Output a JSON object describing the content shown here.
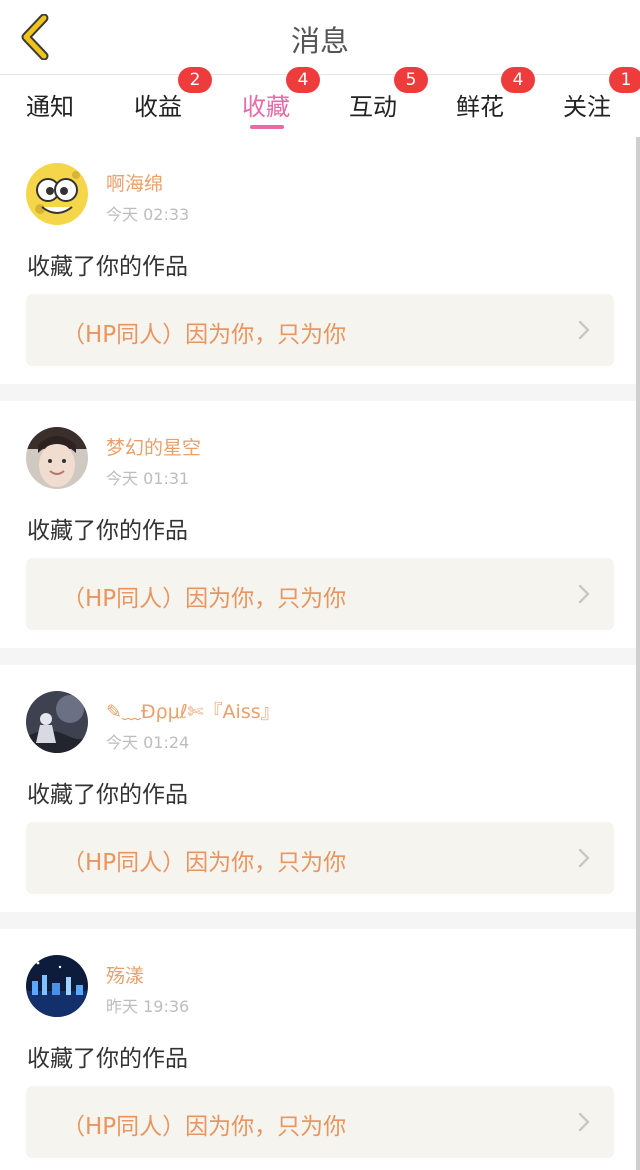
{
  "header": {
    "title": "消息",
    "back_icon": "back-chevron-icon"
  },
  "tabs": [
    {
      "label": "通知",
      "badge": ""
    },
    {
      "label": "收益",
      "badge": "2"
    },
    {
      "label": "收藏",
      "badge": "4",
      "active": true
    },
    {
      "label": "互动",
      "badge": "5"
    },
    {
      "label": "鲜花",
      "badge": "4"
    },
    {
      "label": "关注",
      "badge": "1"
    }
  ],
  "colors": {
    "accent": "#e86aa6",
    "badge": "#ee3b3b",
    "username": "#e9a06a",
    "work_title": "#e9955f",
    "work_bg": "#f6f4ee"
  },
  "messages": [
    {
      "username": "啊海绵",
      "time": "今天 02:33",
      "action": "收藏了你的作品",
      "work_title": "（HP同人）因为你，只为你",
      "avatar": "sponge-avatar"
    },
    {
      "username": "梦幻的星空",
      "time": "今天 01:31",
      "action": "收藏了你的作品",
      "work_title": "（HP同人）因为你，只为你",
      "avatar": "boy-photo-avatar"
    },
    {
      "username": "✎﹏Ðρμℓ✄『Aiss』",
      "time": "今天 01:24",
      "action": "收藏了你的作品",
      "work_title": "（HP同人）因为你，只为你",
      "avatar": "dark-art-avatar"
    },
    {
      "username": "殇漾",
      "time": "昨天 19:36",
      "action": "收藏了你的作品",
      "work_title": "（HP同人）因为你，只为你",
      "avatar": "night-city-avatar"
    }
  ]
}
